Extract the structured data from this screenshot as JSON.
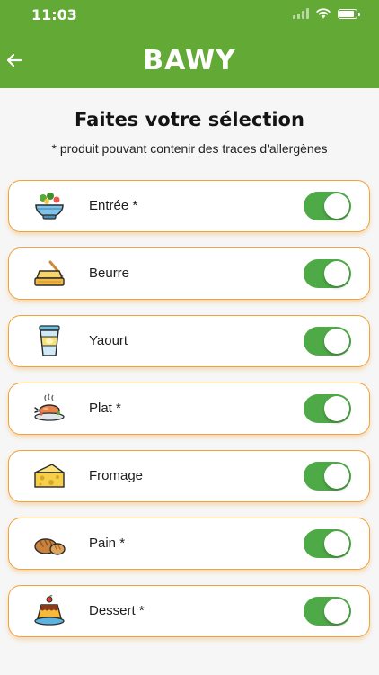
{
  "status_bar": {
    "time": "11:03"
  },
  "header": {
    "title": "BAWY"
  },
  "page": {
    "heading": "Faites votre sélection",
    "subheading": "* produit pouvant contenir des traces d'allergènes"
  },
  "items": [
    {
      "label": "Entrée *",
      "icon": "salad-bowl-icon",
      "enabled": true
    },
    {
      "label": "Beurre",
      "icon": "butter-icon",
      "enabled": true
    },
    {
      "label": "Yaourt",
      "icon": "yogurt-icon",
      "enabled": true
    },
    {
      "label": "Plat *",
      "icon": "roast-dish-icon",
      "enabled": true
    },
    {
      "label": "Fromage",
      "icon": "cheese-icon",
      "enabled": true
    },
    {
      "label": "Pain *",
      "icon": "bread-icon",
      "enabled": true
    },
    {
      "label": "Dessert *",
      "icon": "pudding-icon",
      "enabled": true
    }
  ],
  "colors": {
    "brand_green": "#63a935",
    "toggle_green": "#4eaa47",
    "card_border": "#f0a33a"
  }
}
